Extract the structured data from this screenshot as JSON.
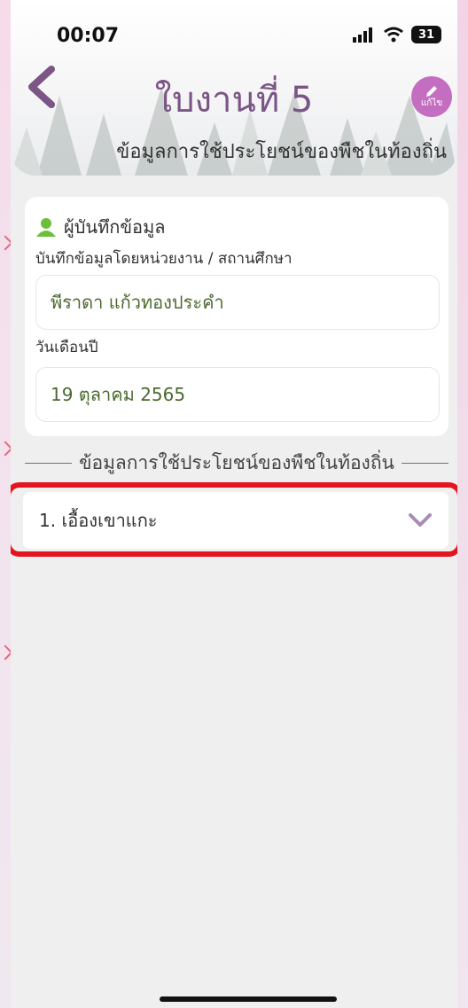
{
  "status": {
    "time": "00:07",
    "battery": "31"
  },
  "header": {
    "title": "ใบงานที่ 5",
    "edit_label": "แก้ไข",
    "subtitle": "ข้อมูลการใช้ประโยชน์ของพืชในท้องถิ่น"
  },
  "recorder": {
    "heading": "ผู้บันทึกข้อมูล",
    "org_label": "บันทึกข้อมูลโดยหน่วยงาน / สถานศึกษา",
    "org_value": "พีราดา แก้วทองประคำ",
    "date_label": "วันเดือนปี",
    "date_value": "19 ตุลาคม 2565"
  },
  "section": {
    "title": "ข้อมูลการใช้ประโยชน์ของพืชในท้องถิ่น"
  },
  "plants": [
    {
      "label": "1. เอื้องเขาแกะ"
    }
  ],
  "colors": {
    "accent": "#7a5585",
    "highlight": "#e3161f",
    "edit_bg": "#c36ec0",
    "field_text": "#4a6a2f"
  }
}
